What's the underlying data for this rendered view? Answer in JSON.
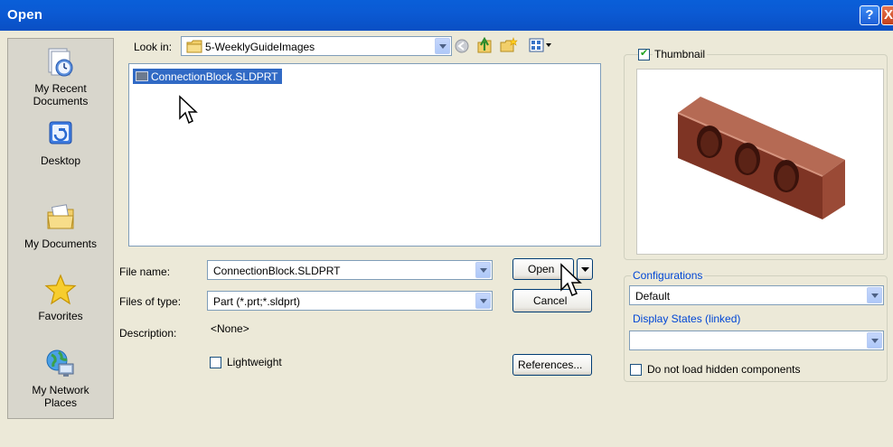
{
  "window": {
    "title": "Open",
    "help_label": "?",
    "close_label": "X"
  },
  "places": [
    {
      "label_lines": [
        "My Recent",
        "Documents"
      ]
    },
    {
      "label_lines": [
        "Desktop"
      ]
    },
    {
      "label_lines": [
        "My Documents"
      ]
    },
    {
      "label_lines": [
        "Favorites"
      ]
    },
    {
      "label_lines": [
        "My Network",
        "Places"
      ]
    }
  ],
  "lookin": {
    "label": "Look in:",
    "value": "5-WeeklyGuideImages"
  },
  "files": [
    {
      "name": "ConnectionBlock.SLDPRT",
      "selected": true
    }
  ],
  "filename": {
    "label": "File name:",
    "value": "ConnectionBlock.SLDPRT"
  },
  "filetype": {
    "label": "Files of type:",
    "value": "Part (*.prt;*.sldprt)"
  },
  "description": {
    "label": "Description:",
    "value": "<None>"
  },
  "buttons": {
    "open": "Open",
    "cancel": "Cancel",
    "references": "References..."
  },
  "lightweight": {
    "label": "Lightweight",
    "checked": false
  },
  "thumbnail": {
    "label": "Thumbnail",
    "checked": true
  },
  "configurations": {
    "label": "Configurations",
    "value": "Default"
  },
  "display_states": {
    "label": "Display States (linked)",
    "value": ""
  },
  "hidden_components": {
    "label": "Do not load hidden components",
    "checked": false
  },
  "colors": {
    "titlebar": "#0a5fd8",
    "selection": "#316ac5",
    "part": "#8a3a28",
    "dialog_bg": "#ece9d8"
  }
}
